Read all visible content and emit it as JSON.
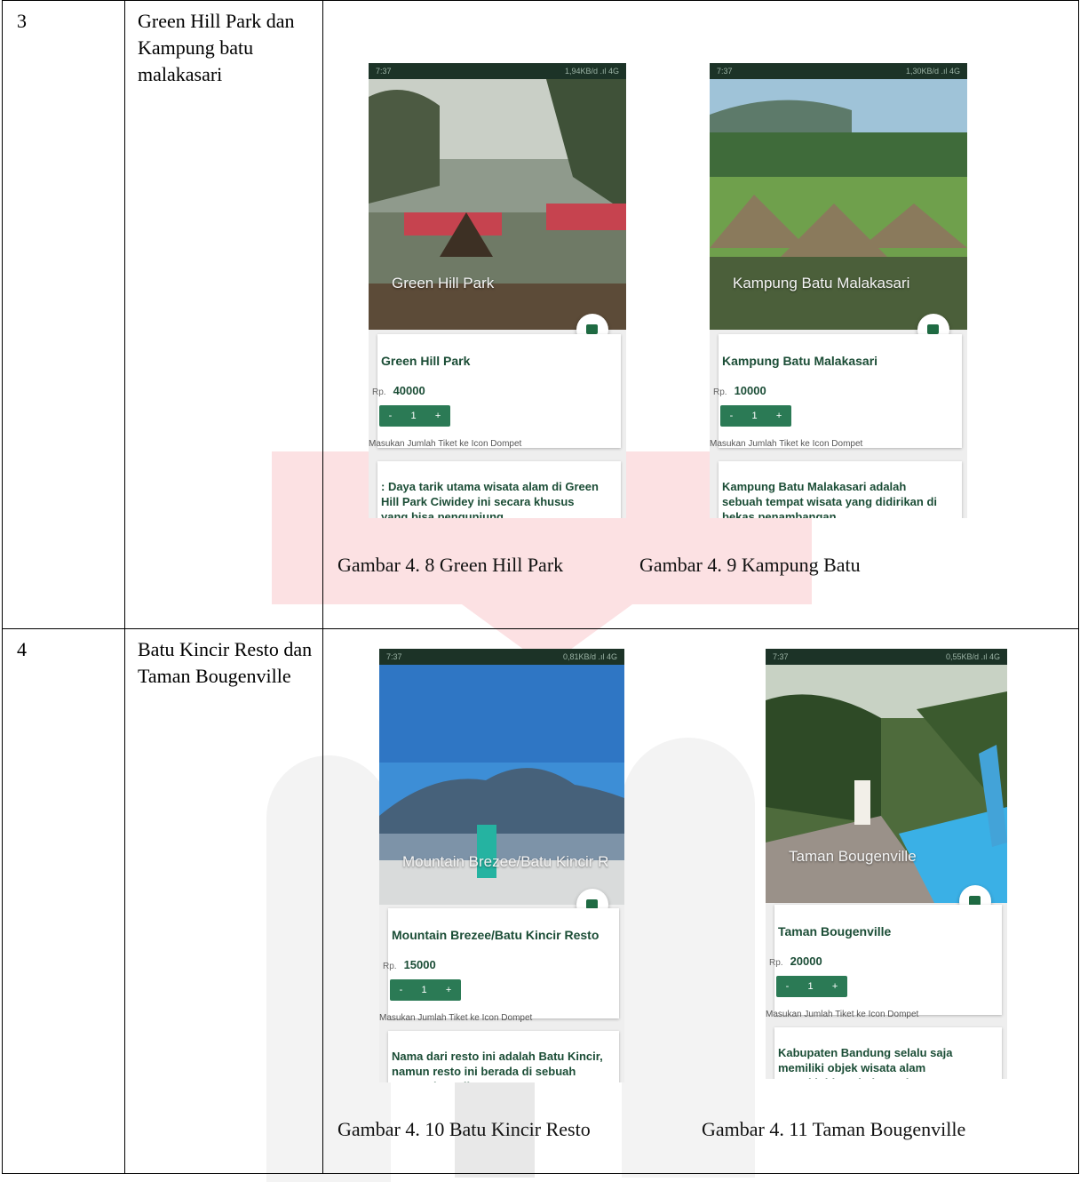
{
  "rows": [
    {
      "number": "3",
      "place": "Green Hill Park dan Kampung batu malakasari",
      "captions": [
        "Gambar 4. 8 Green Hill Park",
        "Gambar 4. 9 Kampung Batu"
      ],
      "screens": [
        {
          "status_time": "7:37",
          "status_right": "1,94KB/d  .ıl 4G ",
          "overlay": "Green Hill Park",
          "title": "Green Hill Park",
          "price_prefix": "Rp.",
          "price": "40000",
          "stepper": [
            "-",
            "1",
            "+"
          ],
          "hint": "Masukan Jumlah Tiket ke Icon Dompet",
          "desc": ": Daya tarik utama wisata alam di Green Hill Park Ciwidey ini secara khusus yang bisa pengunjung"
        },
        {
          "status_time": "7:37",
          "status_right": "1,30KB/d  .ıl 4G ",
          "overlay": "Kampung Batu Malakasari",
          "title": "Kampung Batu Malakasari",
          "price_prefix": "Rp.",
          "price": "10000",
          "stepper": [
            "-",
            "1",
            "+"
          ],
          "hint": "Masukan Jumlah Tiket ke Icon Dompet",
          "desc": "Kampung Batu Malakasari adalah sebuah tempat wisata yang didirikan di bekas penambangan"
        }
      ]
    },
    {
      "number": "4",
      "place": "Batu Kincir Resto dan Taman Bougenville",
      "captions": [
        "Gambar 4. 10 Batu Kincir Resto",
        "Gambar 4. 11 Taman Bougenville"
      ],
      "screens": [
        {
          "status_time": "7:37",
          "status_right": "0,81KB/d  .ıl 4G ",
          "overlay": "Mountain Brezee/Batu Kincir R",
          "title": "Mountain Brezee/Batu Kincir Resto",
          "price_prefix": "Rp.",
          "price": "15000",
          "stepper": [
            "-",
            "1",
            "+"
          ],
          "hint": "Masukan Jumlah Tiket ke Icon Dompet",
          "desc": "Nama dari resto ini adalah Batu Kincir, namun resto ini berada di sebuah perumahan elit yang"
        },
        {
          "status_time": "7:37",
          "status_right": "0,55KB/d  .ıl 4G ",
          "overlay": "Taman Bougenville",
          "title": "Taman Bougenville",
          "price_prefix": "Rp.",
          "price": "20000",
          "stepper": [
            "-",
            "1",
            "+"
          ],
          "hint": "Masukan Jumlah Tiket ke Icon Dompet",
          "desc": "Kabupaten Bandung selalu saja memiliki objek wisata alam menakjubkan, hal tersebut"
        }
      ]
    }
  ]
}
